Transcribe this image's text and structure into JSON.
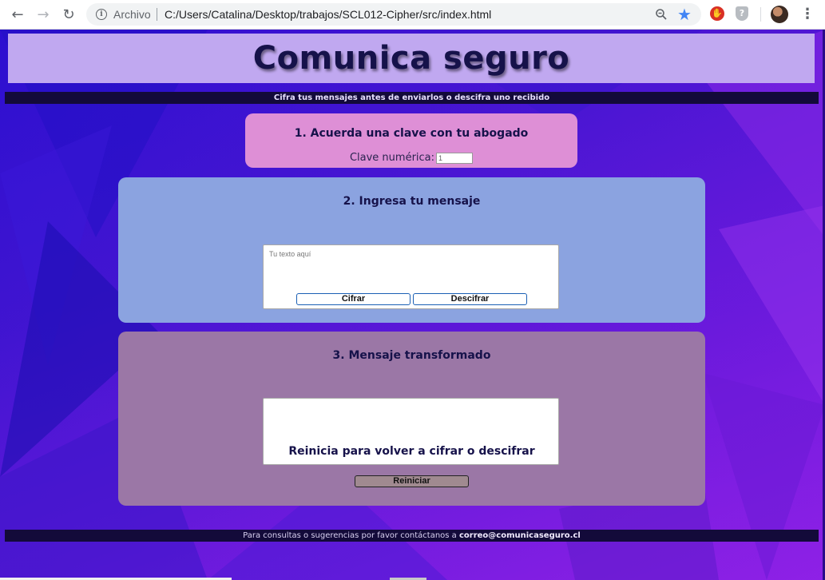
{
  "browser": {
    "back_icon": "arrow-left-icon",
    "forward_icon": "arrow-right-icon",
    "reload_icon": "reload-icon",
    "site_info_label": "Archivo",
    "url": "C:/Users/Catalina/Desktop/trabajos/SCL012-Cipher/src/index.html",
    "zoom_icon": "zoom-icon",
    "bookmark_icon": "star-icon",
    "extensions": [
      "adblock-icon",
      "shield-icon"
    ],
    "menu_icon": "more-vert-icon"
  },
  "header": {
    "title": "Comunica seguro",
    "subtitle": "Cifra tus mensajes antes de enviarlos o descifra uno recibido"
  },
  "step1": {
    "heading": "1. Acuerda una clave con tu abogado",
    "key_label": "Clave numérica:",
    "key_value": "1"
  },
  "step2": {
    "heading": "2. Ingresa tu mensaje",
    "placeholder": "Tu texto aquí",
    "cipher_label": "Cifrar",
    "decipher_label": "Descifrar"
  },
  "step3": {
    "heading": "3. Mensaje transformado",
    "output_value": "",
    "reset_text": "Reinicia para volver a cifrar o descifrar",
    "reset_label": "Reiniciar"
  },
  "footer": {
    "text": "Para consultas o sugerencias por favor contáctanos a",
    "email": "correo@comunicaseguro.cl"
  },
  "colors": {
    "banner": "#c0a8f0",
    "title": "#16124a",
    "card_key": "#de8fd6",
    "card_msg": "#8ba3e0",
    "card_out": "#9b77a6",
    "bar": "#130a3a"
  }
}
